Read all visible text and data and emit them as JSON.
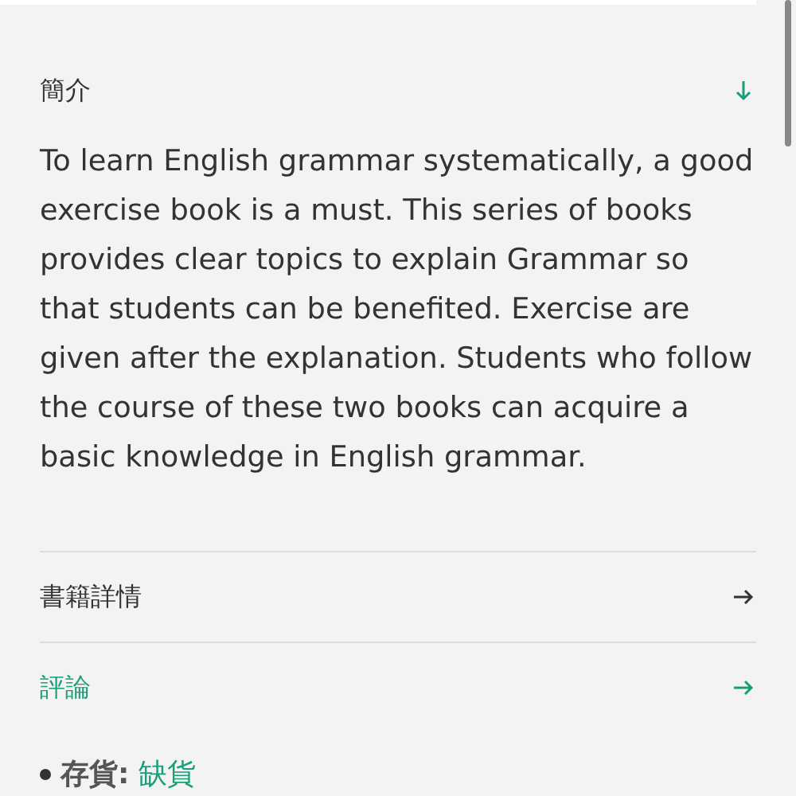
{
  "intro": {
    "title": "簡介",
    "expanded": true,
    "text": "To learn English grammar systematically, a good exercise book is a must. This series of books provides clear topics to explain Grammar so that students can be benefited. Exercise are given after the explanation. Students who follow the course of these two books can acquire a basic knowledge in English grammar."
  },
  "links": [
    {
      "label": "書籍詳情",
      "selected": false
    },
    {
      "label": "評論",
      "selected": true
    }
  ],
  "stock": {
    "label": "存貨:",
    "value": "缺貨"
  }
}
